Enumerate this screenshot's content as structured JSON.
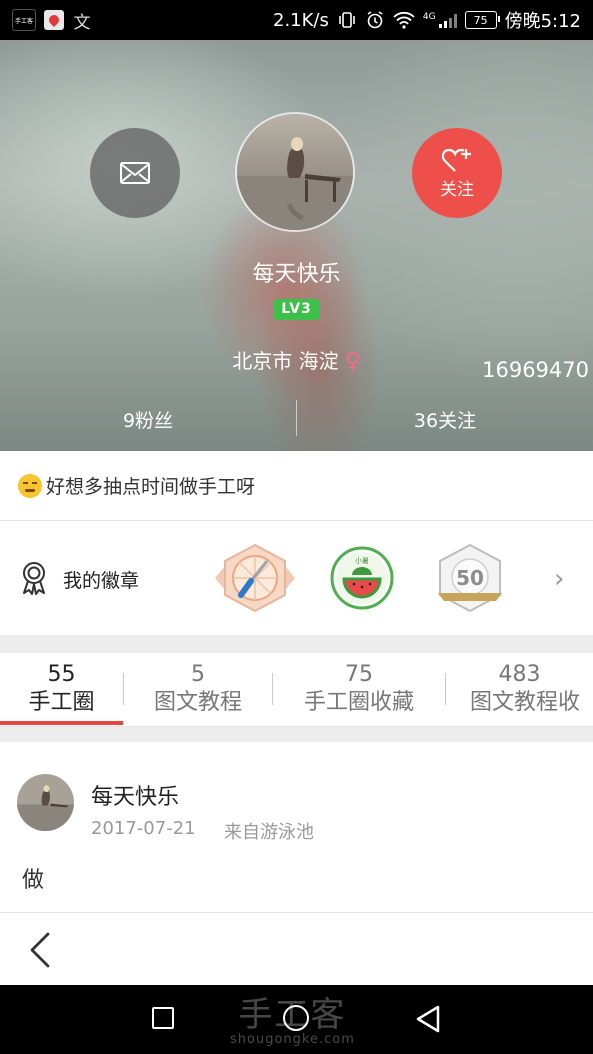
{
  "status_bar": {
    "app_icon_label": "手工客",
    "ime_icon": "文",
    "speed": "2.1K/s",
    "network": "4G",
    "battery": "75",
    "time": "傍晚5:12"
  },
  "profile": {
    "username": "每天快乐",
    "level": "LV3",
    "location": "北京市 海淀",
    "gender_symbol": "♀",
    "user_id": "16969470",
    "fans": "9粉丝",
    "following": "36关注",
    "follow_label": "关注"
  },
  "signature": "好想多抽点时间做手工呀",
  "badges": {
    "title": "我的徽章",
    "watermelon_label": "小暑",
    "anniversary_number": "50"
  },
  "tabs": [
    {
      "count": "55",
      "label": "手工圈"
    },
    {
      "count": "5",
      "label": "图文教程"
    },
    {
      "count": "75",
      "label": "手工圈收藏"
    },
    {
      "count": "483",
      "label": "图文教程收"
    }
  ],
  "post": {
    "author": "每天快乐",
    "date": "2017-07-21",
    "source": "来自游泳池",
    "content": "做"
  },
  "watermark": {
    "main": "手工客",
    "sub": "shougongke.com"
  },
  "colors": {
    "accent_red": "#ef4f4a",
    "level_green": "#3cc04a",
    "tab_underline": "#e64545"
  }
}
